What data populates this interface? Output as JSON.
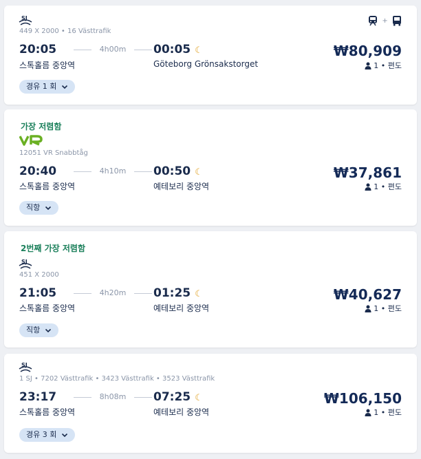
{
  "results": [
    {
      "badge": "",
      "train_info": "449 X 2000 • 16 Västtrafik",
      "depart_time": "20:05",
      "duration": "4h00m",
      "arrive_time": "00:05",
      "depart_station": "스톡홀름 중앙역",
      "arrive_station": "Göteborg Grönsakstorget",
      "price": "₩80,909",
      "passengers": "1",
      "trip_type": "편도",
      "stops_label": "경유 1 회",
      "modes_sep": "+",
      "operator_logo": "SJ"
    },
    {
      "badge": "가장 저렴함",
      "train_info": "12051 VR Snabbtåg",
      "depart_time": "20:40",
      "duration": "4h10m",
      "arrive_time": "00:50",
      "depart_station": "스톡홀름 중앙역",
      "arrive_station": "예테보리 중앙역",
      "price": "₩37,861",
      "passengers": "1",
      "trip_type": "편도",
      "stops_label": "직항",
      "operator_logo": "VR"
    },
    {
      "badge": "2번째 가장 저렴함",
      "train_info": "451 X 2000",
      "depart_time": "21:05",
      "duration": "4h20m",
      "arrive_time": "01:25",
      "depart_station": "스톡홀름 중앙역",
      "arrive_station": "예테보리 중앙역",
      "price": "₩40,627",
      "passengers": "1",
      "trip_type": "편도",
      "stops_label": "직항",
      "operator_logo": "SJ"
    },
    {
      "badge": "",
      "train_info": "1 SJ • 7202 Västtrafik • 3423 Västtrafik • 3523 Västtrafik",
      "depart_time": "23:17",
      "duration": "8h08m",
      "arrive_time": "07:25",
      "depart_station": "스톡홀름 중앙역",
      "arrive_station": "예테보리 중앙역",
      "price": "₩106,150",
      "passengers": "1",
      "trip_type": "편도",
      "stops_label": "경유 3 회",
      "operator_logo": "SJ"
    }
  ],
  "colors": {
    "badge_green": "#1a7f5a",
    "price_navy": "#142a57",
    "chip_bg": "#d6e4f5",
    "moon": "#e0a020",
    "vr_green": "#6ab023"
  },
  "icons": [
    "sj-logo-icon",
    "vr-logo-icon",
    "train-icon",
    "bus-icon",
    "moon-icon",
    "person-icon",
    "chevron-down-icon"
  ]
}
